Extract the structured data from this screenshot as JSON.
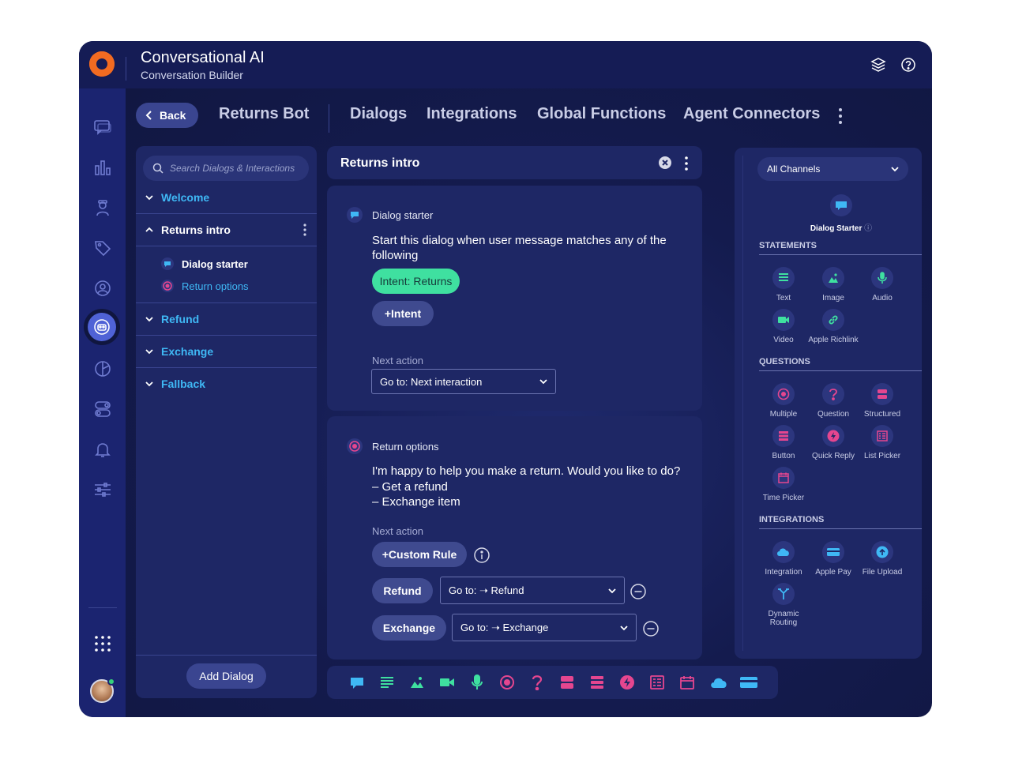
{
  "app": {
    "title": "Conversational AI",
    "subtitle": "Conversation Builder"
  },
  "topnav": {
    "back_label": "Back",
    "bot_name": "Returns Bot",
    "tabs": [
      "Dialogs",
      "Integrations",
      "Global Functions",
      "Agent Connectors"
    ]
  },
  "left": {
    "search_placeholder": "Search Dialogs & Interactions",
    "dialogs": [
      "Welcome",
      "Returns intro",
      "Refund",
      "Exchange",
      "Fallback"
    ],
    "interactions": [
      "Dialog starter",
      "Return options"
    ],
    "add_dialog": "Add Dialog"
  },
  "center": {
    "dialog_title": "Returns intro",
    "card1": {
      "title": "Dialog starter",
      "text": "Start this dialog when user message matches any of the following",
      "intent": "Intent: Returns",
      "add_intent": "+Intent",
      "next_action_label": "Next action",
      "next_action_value": "Go to: Next interaction"
    },
    "card2": {
      "title": "Return options",
      "text_line1": "I'm happy to help you make a return. Would you like to do?",
      "text_line2": "– Get a refund",
      "text_line3": "– Exchange item",
      "next_action_label": "Next action",
      "custom_rule": "+Custom Rule",
      "rules": [
        {
          "label": "Refund",
          "target": "Go to: ➝ Refund"
        },
        {
          "label": "Exchange",
          "target": "Go to: ➝ Exchange"
        }
      ]
    }
  },
  "right": {
    "channel": "All Channels",
    "starter_label": "Dialog Starter",
    "sections": {
      "statements": "STATEMENTS",
      "questions": "QUESTIONS",
      "integrations": "INTEGRATIONS"
    },
    "statements": [
      "Text",
      "Image",
      "Audio",
      "Video",
      "Apple Richlink"
    ],
    "questions": [
      "Multiple",
      "Question",
      "Structured",
      "Button",
      "Quick Reply",
      "List Picker",
      "Time Picker"
    ],
    "integrations": [
      "Integration",
      "Apple Pay",
      "File Upload",
      "Dynamic Routing"
    ]
  },
  "colors": {
    "accent_blue": "#3fb8f5",
    "accent_green": "#3fe0a0",
    "accent_pink": "#e5468f",
    "brand_orange": "#f26b21"
  }
}
